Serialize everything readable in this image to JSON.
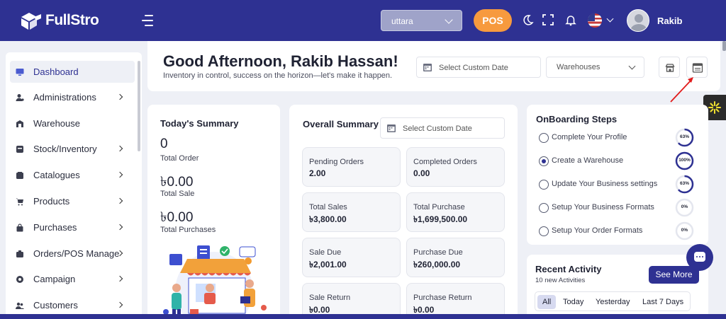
{
  "header": {
    "brand": "FullStro",
    "location_select": "uttara",
    "pos_label": "POS",
    "user_name": "Rakib"
  },
  "sidebar": {
    "items": [
      {
        "label": "Dashboard",
        "icon": "monitor-icon",
        "has_submenu": false,
        "active": true
      },
      {
        "label": "Administrations",
        "icon": "user-gear-icon",
        "has_submenu": true
      },
      {
        "label": "Warehouse",
        "icon": "warehouse-icon",
        "has_submenu": false
      },
      {
        "label": "Stock/Inventory",
        "icon": "stock-icon",
        "has_submenu": true
      },
      {
        "label": "Catalogues",
        "icon": "catalogue-icon",
        "has_submenu": true
      },
      {
        "label": "Products",
        "icon": "cart-icon",
        "has_submenu": true
      },
      {
        "label": "Purchases",
        "icon": "bag-icon",
        "has_submenu": true
      },
      {
        "label": "Orders/POS Manage",
        "icon": "orders-icon",
        "has_submenu": true
      },
      {
        "label": "Campaign",
        "icon": "campaign-icon",
        "has_submenu": true
      },
      {
        "label": "Customers",
        "icon": "customers-icon",
        "has_submenu": true
      }
    ]
  },
  "greeting": {
    "title": "Good Afternoon, Rakib Hassan!",
    "subtitle": "Inventory in control, success on the horizon—let's make it happen.",
    "date_placeholder": "Select Custom Date",
    "warehouse_select": "Warehouses"
  },
  "today_summary": {
    "title": "Today's Summary",
    "total_order_value": "0",
    "total_order_label": "Total Order",
    "total_sale_value": "৳0.00",
    "total_sale_label": "Total Sale",
    "total_purchases_value": "৳0.00",
    "total_purchases_label": "Total Purchases"
  },
  "overall_summary": {
    "title": "Overall Summary",
    "date_placeholder": "Select Custom Date",
    "stats": [
      {
        "label": "Pending Orders",
        "value": "2.00"
      },
      {
        "label": "Completed Orders",
        "value": "0.00"
      },
      {
        "label": "Total Sales",
        "value": "৳3,800.00"
      },
      {
        "label": "Total Purchase",
        "value": "৳1,699,500.00"
      },
      {
        "label": "Sale Due",
        "value": "৳2,001.00"
      },
      {
        "label": "Purchase Due",
        "value": "৳260,000.00"
      },
      {
        "label": "Sale Return",
        "value": "৳0.00"
      },
      {
        "label": "Purchase Return",
        "value": "৳0.00"
      }
    ]
  },
  "onboarding": {
    "title": "OnBoarding Steps",
    "steps": [
      {
        "label": "Complete Your Profile",
        "progress_label": "63%",
        "progress": 0.63,
        "checked": false
      },
      {
        "label": "Create a Warehouse",
        "progress_label": "100%",
        "progress": 1.0,
        "checked": true
      },
      {
        "label": "Update Your Business settings",
        "progress_label": "63%",
        "progress": 0.63,
        "checked": false
      },
      {
        "label": "Setup Your Business Formats",
        "progress_label": "0%",
        "progress": 0,
        "checked": false
      },
      {
        "label": "Setup Your Order Formats",
        "progress_label": "0%",
        "progress": 0,
        "checked": false
      }
    ]
  },
  "recent_activity": {
    "title": "Recent Activity",
    "subtitle": "10 new Activities",
    "see_more": "See More",
    "tabs": [
      "All",
      "Today",
      "Yesterday",
      "Last 7 Days"
    ]
  },
  "colors": {
    "primary": "#2e3192",
    "accent": "#f79a3e",
    "background": "#eef0f6"
  }
}
